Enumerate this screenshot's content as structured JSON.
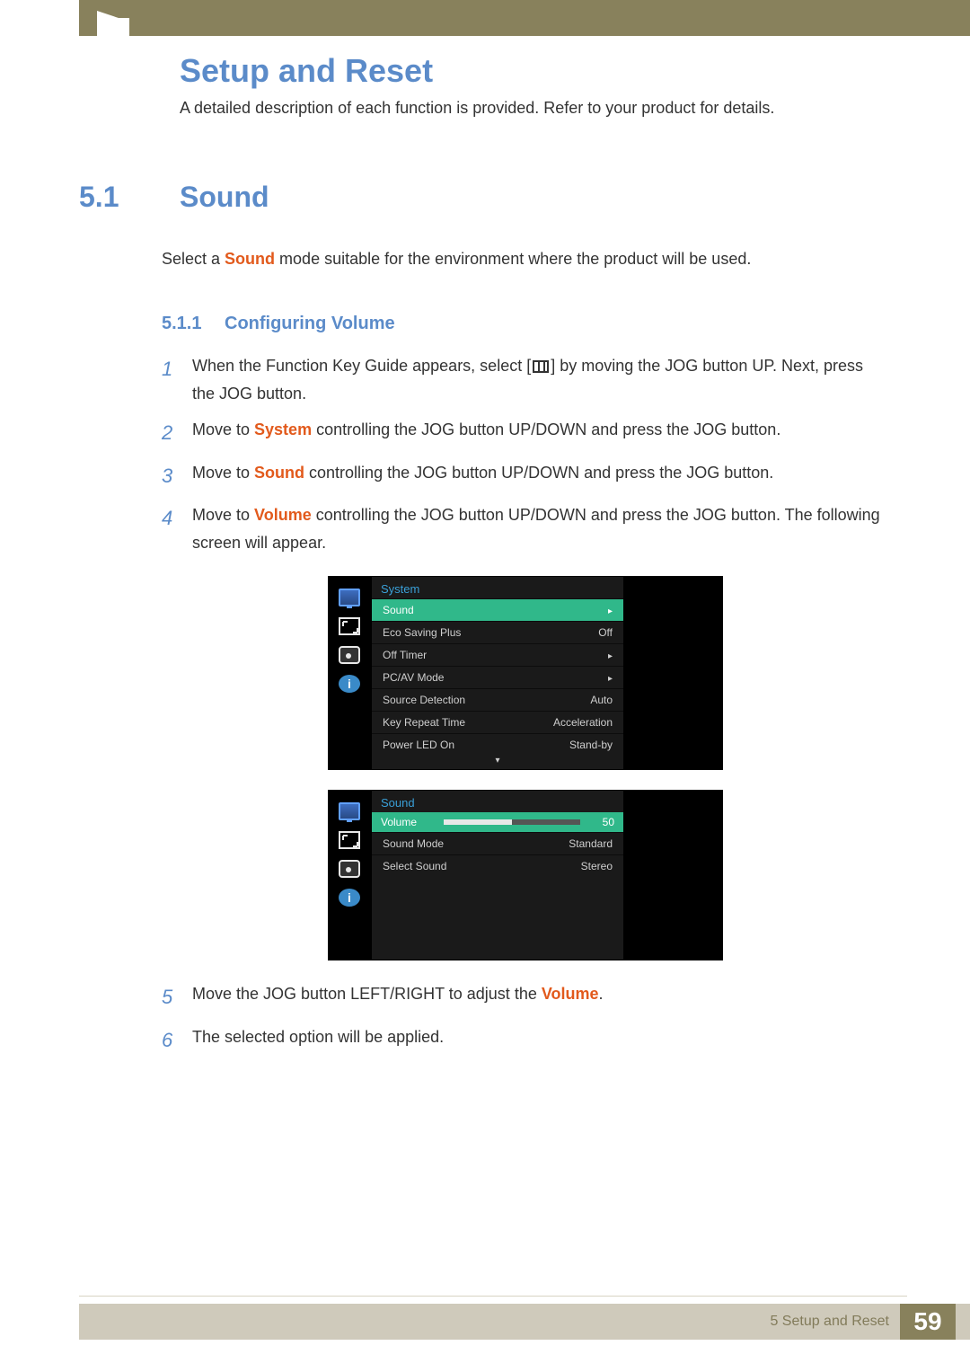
{
  "chapter": {
    "title": "Setup and Reset",
    "subtitle": "A detailed description of each function is provided. Refer to your product for details."
  },
  "section": {
    "number": "5.1",
    "title": "Sound",
    "intro_pre": "Select a ",
    "intro_hl": "Sound",
    "intro_post": " mode suitable for the environment where the product will be used."
  },
  "subsection": {
    "number": "5.1.1",
    "title": "Configuring Volume"
  },
  "steps": {
    "s1_a": "When the Function Key Guide appears, select [",
    "s1_b": "] by moving the JOG button UP. Next, press the JOG button.",
    "s2_a": "Move to ",
    "s2_hl": "System",
    "s2_b": " controlling the JOG button UP/DOWN and press the JOG button.",
    "s3_a": "Move to ",
    "s3_hl": "Sound",
    "s3_b": " controlling the JOG button UP/DOWN and press the JOG button.",
    "s4_a": "Move to ",
    "s4_hl": "Volume",
    "s4_b": " controlling the JOG button UP/DOWN and press the JOG button. The following screen will appear.",
    "s5_a": "Move the JOG button LEFT/RIGHT to adjust the ",
    "s5_hl": "Volume",
    "s5_b": ".",
    "s6": "The selected option will be applied.",
    "n1": "1",
    "n2": "2",
    "n3": "3",
    "n4": "4",
    "n5": "5",
    "n6": "6"
  },
  "osd1": {
    "title": "System",
    "rows": [
      {
        "label": "Sound",
        "value": "",
        "sel": true,
        "arrow": true
      },
      {
        "label": "Eco Saving Plus",
        "value": "Off"
      },
      {
        "label": "Off Timer",
        "value": "",
        "arrow": true
      },
      {
        "label": "PC/AV Mode",
        "value": "",
        "arrow": true
      },
      {
        "label": "Source Detection",
        "value": "Auto"
      },
      {
        "label": "Key Repeat Time",
        "value": "Acceleration"
      },
      {
        "label": "Power LED On",
        "value": "Stand-by"
      }
    ]
  },
  "osd2": {
    "title": "Sound",
    "volume_label": "Volume",
    "volume_value": "50",
    "rows": [
      {
        "label": "Sound Mode",
        "value": "Standard"
      },
      {
        "label": "Select Sound",
        "value": "Stereo"
      }
    ]
  },
  "footer": {
    "label": "5 Setup and Reset",
    "page": "59"
  }
}
